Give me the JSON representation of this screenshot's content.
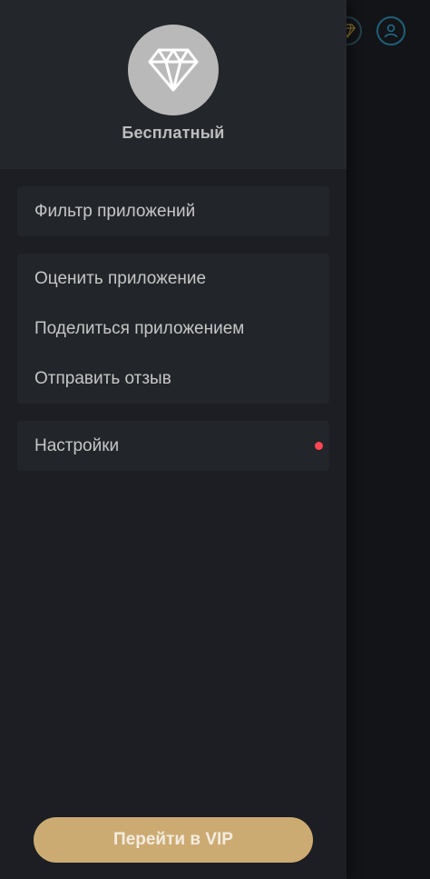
{
  "drawer": {
    "plan_label": "Бесплатный",
    "avatar_icon": "diamond-icon",
    "menu_groups": [
      {
        "items": [
          {
            "label": "Фильтр приложений"
          }
        ]
      },
      {
        "items": [
          {
            "label": "Оценить приложение"
          },
          {
            "label": "Поделиться приложением"
          },
          {
            "label": "Отправить отзыв"
          }
        ]
      },
      {
        "items": [
          {
            "label": "Настройки",
            "badge": "red-dot"
          }
        ]
      }
    ],
    "vip_button_label": "Перейти в VIP"
  },
  "background": {
    "icons": [
      "diamond-icon",
      "profile-icon"
    ]
  },
  "colors": {
    "drawer_bg": "#1c1e23",
    "header_bg": "#23262b",
    "group_bg": "#22252a",
    "accent_gold": "#ccab73",
    "badge_red": "#ff4752"
  }
}
